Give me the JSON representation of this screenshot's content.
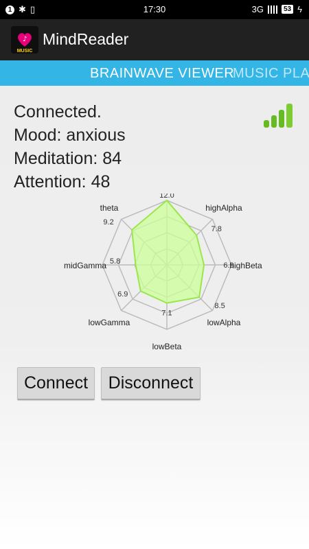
{
  "status_bar": {
    "notification_badge": "1",
    "time": "17:30",
    "network": "3G",
    "battery": "53"
  },
  "app": {
    "title": "MindReader",
    "icon_text": "MUSIC"
  },
  "tabs": [
    {
      "label": "BRAINWAVE VIEWER",
      "active": true
    },
    {
      "label": "MUSIC PLAY",
      "active": false
    }
  ],
  "status": {
    "connection": "Connected.",
    "mood": "Mood: anxious",
    "meditation": "Meditation: 84",
    "attention": "Attention: 48"
  },
  "chart_data": {
    "type": "radar",
    "categories": [
      "theta",
      "highAlpha",
      "highBeta",
      "lowAlpha",
      "lowBeta",
      "lowGamma",
      "midGamma"
    ],
    "series": [
      {
        "values": [
          9.2,
          7.8,
          6.9,
          8.5,
          7.1,
          6.9,
          5.8
        ]
      }
    ],
    "value_labels": [
      "12.0",
      "7.8",
      "6.9",
      "8.5",
      "7.1",
      "6.9",
      "5.8",
      "9.2"
    ],
    "axis_names": [
      "highAlpha",
      "highBeta",
      "lowAlpha",
      "lowBeta",
      "lowGamma",
      "midGamma",
      "theta"
    ],
    "rlim": [
      0,
      12
    ],
    "grid": true,
    "colors": {
      "fill": "#ccff99",
      "stroke": "#99e64d",
      "grid": "#bbbbbb"
    }
  },
  "buttons": {
    "connect": "Connect",
    "disconnect": "Disconnect"
  },
  "colors": {
    "tab_bar": "#33b5e5",
    "app_bar": "#212121",
    "signal_green": "#66bb22"
  }
}
